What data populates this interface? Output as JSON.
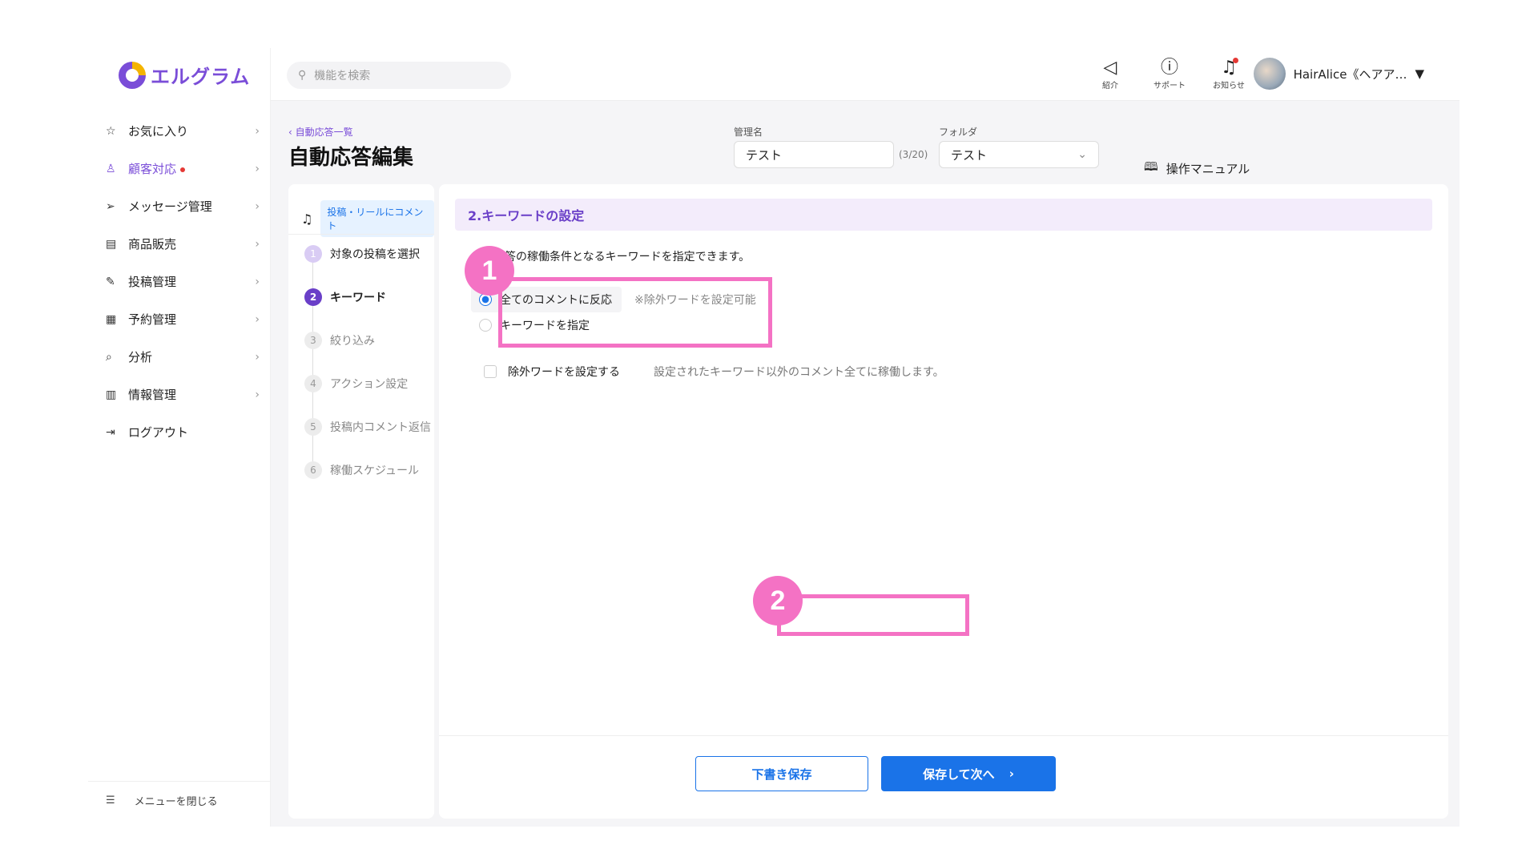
{
  "app": {
    "logo_text": "エルグラム"
  },
  "search": {
    "placeholder": "機能を検索"
  },
  "header": {
    "icons": [
      {
        "icon": "megaphone-icon",
        "label": "紹介"
      },
      {
        "icon": "help-icon",
        "label": "サポート"
      },
      {
        "icon": "bell-icon",
        "label": "お知らせ"
      }
    ],
    "user_name": "HairAlice《ヘアア…"
  },
  "sidebar": {
    "items": [
      {
        "icon": "star-icon",
        "label": "お気に入り"
      },
      {
        "icon": "person-icon",
        "label": "顧客対応"
      },
      {
        "icon": "send-icon",
        "label": "メッセージ管理"
      },
      {
        "icon": "shop-icon",
        "label": "商品販売"
      },
      {
        "icon": "edit-icon",
        "label": "投稿管理"
      },
      {
        "icon": "calendar-icon",
        "label": "予約管理"
      },
      {
        "icon": "analysis-icon",
        "label": "分析"
      },
      {
        "icon": "chart-icon",
        "label": "情報管理"
      },
      {
        "icon": "logout-icon",
        "label": "ログアウト"
      }
    ],
    "close_label": "メニューを閉じる"
  },
  "page": {
    "breadcrumb": "自動応答一覧",
    "title": "自動応答編集",
    "name_label": "管理名",
    "name_value": "テスト",
    "name_counter": "(3/20)",
    "folder_label": "フォルダ",
    "folder_value": "テスト",
    "manual_label": "操作マニュアル"
  },
  "steps": {
    "type_badge": "投稿・リールにコメント",
    "items": [
      {
        "num": "1",
        "label": "対象の投稿を選択",
        "state": "done"
      },
      {
        "num": "2",
        "label": "キーワード",
        "state": "current"
      },
      {
        "num": "3",
        "label": "絞り込み",
        "state": "todo"
      },
      {
        "num": "4",
        "label": "アクション設定",
        "state": "todo"
      },
      {
        "num": "5",
        "label": "投稿内コメント返信",
        "state": "todo"
      },
      {
        "num": "6",
        "label": "稼働スケジュール",
        "state": "todo"
      }
    ]
  },
  "keyword": {
    "section_title": "2.キーワードの設定",
    "description": "自動応答の稼働条件となるキーワードを指定できます。",
    "option_all": "全てのコメントに反応",
    "option_all_hint": "※除外ワードを設定可能",
    "option_specify": "キーワードを指定",
    "exclude_label": "除外ワードを設定する",
    "exclude_hint": "設定されたキーワード以外のコメント全てに稼働します。"
  },
  "footer": {
    "draft_label": "下書き保存",
    "next_label": "保存して次へ"
  },
  "annotations": {
    "badge1": "1",
    "badge2": "2",
    "color": "#f472c4"
  }
}
